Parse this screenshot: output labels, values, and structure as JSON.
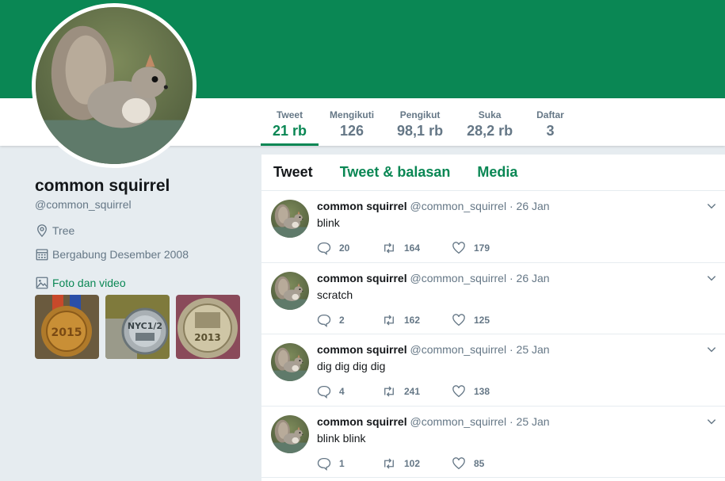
{
  "profile": {
    "name": "common squirrel",
    "handle": "@common_squirrel",
    "location": "Tree",
    "joined": "Bergabung Desember 2008",
    "media_label": "Foto dan video",
    "brand_color": "#0a8754",
    "avatar_icon": "squirrel-photo",
    "media_thumbs": [
      "medal-2015",
      "medal-nyc-half",
      "medal-2013-marathon"
    ]
  },
  "stats": [
    {
      "label": "Tweet",
      "value": "21 rb",
      "active": true
    },
    {
      "label": "Mengikuti",
      "value": "126"
    },
    {
      "label": "Pengikut",
      "value": "98,1 rb"
    },
    {
      "label": "Suka",
      "value": "28,2 rb"
    },
    {
      "label": "Daftar",
      "value": "3"
    }
  ],
  "tabs": [
    {
      "label": "Tweet",
      "active": true
    },
    {
      "label": "Tweet & balasan"
    },
    {
      "label": "Media"
    }
  ],
  "tweets": [
    {
      "name": "common squirrel",
      "handle": "@common_squirrel",
      "sep": "·",
      "date": "26 Jan",
      "text": "blink",
      "replies": "20",
      "retweets": "164",
      "likes": "179"
    },
    {
      "name": "common squirrel",
      "handle": "@common_squirrel",
      "sep": "·",
      "date": "26 Jan",
      "text": "scratch",
      "replies": "2",
      "retweets": "162",
      "likes": "125"
    },
    {
      "name": "common squirrel",
      "handle": "@common_squirrel",
      "sep": "·",
      "date": "25 Jan",
      "text": "dig dig dig dig",
      "replies": "4",
      "retweets": "241",
      "likes": "138"
    },
    {
      "name": "common squirrel",
      "handle": "@common_squirrel",
      "sep": "·",
      "date": "25 Jan",
      "text": "blink blink",
      "replies": "1",
      "retweets": "102",
      "likes": "85"
    }
  ]
}
